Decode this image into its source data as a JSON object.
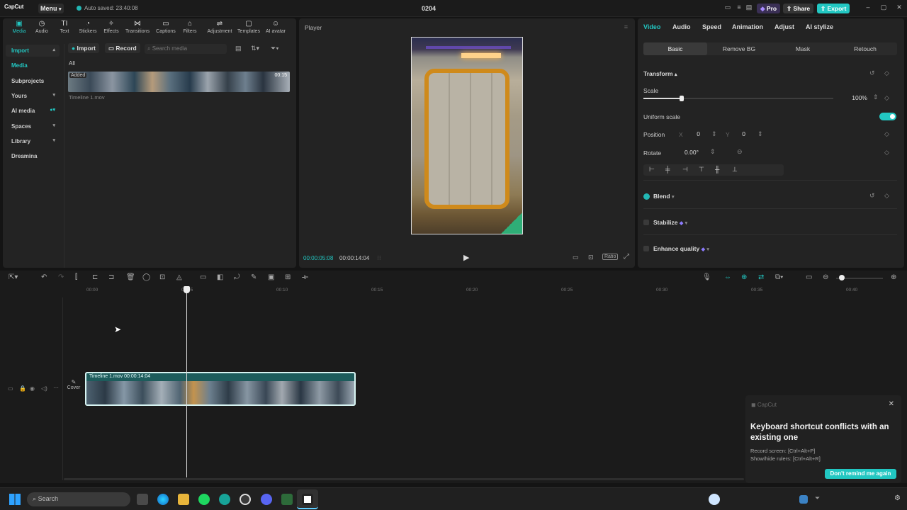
{
  "titlebar": {
    "app_name": "CapCut",
    "menu_label": "Menu",
    "autosave": "Auto saved: 23:40:08",
    "project_title": "0204",
    "pro_label": "Pro",
    "share_label": "Share",
    "export_label": "Export",
    "accent": "#22c7c2"
  },
  "toolbar": [
    {
      "label": "Media",
      "icon": "media-icon"
    },
    {
      "label": "Audio",
      "icon": "audio-icon"
    },
    {
      "label": "Text",
      "icon": "text-icon"
    },
    {
      "label": "Stickers",
      "icon": "stickers-icon"
    },
    {
      "label": "Effects",
      "icon": "effects-icon"
    },
    {
      "label": "Transitions",
      "icon": "transitions-icon"
    },
    {
      "label": "Captions",
      "icon": "captions-icon"
    },
    {
      "label": "Filters",
      "icon": "filters-icon"
    },
    {
      "label": "Adjustment",
      "icon": "adjustment-icon"
    },
    {
      "label": "Templates",
      "icon": "templates-icon"
    },
    {
      "label": "AI avatar",
      "icon": "ai-avatar-icon"
    }
  ],
  "nav": [
    {
      "label": "Import"
    },
    {
      "label": "Media"
    },
    {
      "label": "Subprojects"
    },
    {
      "label": "Yours"
    },
    {
      "label": "AI media"
    },
    {
      "label": "Spaces"
    },
    {
      "label": "Library"
    },
    {
      "label": "Dreamina"
    }
  ],
  "media": {
    "import_button": "Import",
    "record_button": "Record",
    "search_placeholder": "Search media",
    "filter_all": "All",
    "added_badge": "Added",
    "duration": "00:15",
    "file_name": "Timeline 1.mov"
  },
  "player": {
    "title": "Player",
    "current_time": "00:00:05:08",
    "total_time": "00:00:14:04",
    "ratio_label": "Ratio"
  },
  "inspector": {
    "tabs": [
      "Video",
      "Audio",
      "Speed",
      "Animation",
      "Adjust",
      "AI stylize"
    ],
    "subtabs": [
      "Basic",
      "Remove BG",
      "Mask",
      "Retouch"
    ],
    "transform_label": "Transform",
    "scale_label": "Scale",
    "scale_value": "100%",
    "scale_fraction": 0.2,
    "uniform_scale_label": "Uniform scale",
    "position_label": "Position",
    "pos_x_label": "X",
    "pos_x": "0",
    "pos_y_label": "Y",
    "pos_y": "0",
    "rotate_label": "Rotate",
    "rotate_value": "0.00°",
    "blend_label": "Blend",
    "stabilize_label": "Stabilize",
    "enhance_label": "Enhance quality"
  },
  "timeline": {
    "ticks": [
      "00:00",
      "00:05",
      "00:10",
      "00:15",
      "00:20",
      "00:25",
      "00:30",
      "00:35",
      "00:40"
    ],
    "cover_label": "Cover",
    "clip_label": "Timeline 1.mov  00:00:14:04"
  },
  "notification": {
    "app_name": "CapCut",
    "title": "Keyboard shortcut conflicts with an existing one",
    "line1": "Record screen: [Ctrl+Alt+P]",
    "line2": "Show/hide rulers: [Ctrl+Alt+R]",
    "dismiss_button": "Don't remind me again"
  },
  "taskbar": {
    "search_placeholder": "Search"
  }
}
